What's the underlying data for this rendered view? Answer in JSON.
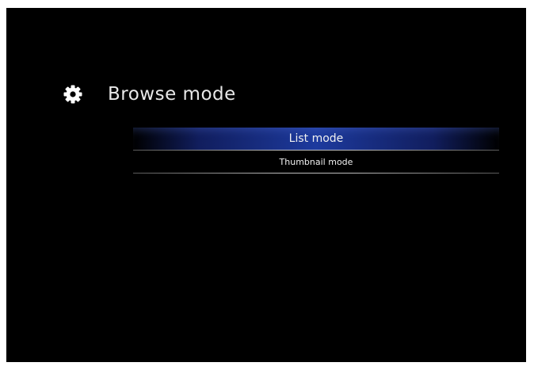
{
  "header": {
    "icon": "gear-icon",
    "title": "Browse mode"
  },
  "menu": {
    "items": [
      {
        "label": "List mode",
        "selected": true
      },
      {
        "label": "Thumbnail mode",
        "selected": false
      }
    ]
  },
  "colors": {
    "background": "#000000",
    "highlight": "#1d3a9e",
    "text": "#f0f0f0"
  }
}
